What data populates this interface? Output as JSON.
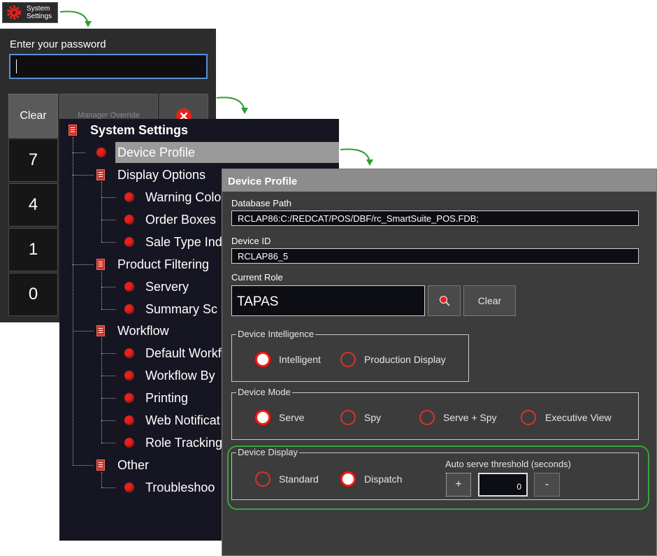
{
  "launcher": {
    "label_line1": "System",
    "label_line2": "Settings",
    "icon": "gear-icon"
  },
  "password_panel": {
    "label": "Enter your password",
    "input_value": "",
    "clear_label": "Clear",
    "manager_override_label": "Manager Override",
    "close_icon": "close-icon",
    "keys": [
      "7",
      "4",
      "1",
      "0"
    ]
  },
  "tree": {
    "title": "System Settings",
    "items": [
      {
        "label": "Device Profile",
        "level": 1,
        "type": "leaf",
        "selected": true
      },
      {
        "label": "Display Options",
        "level": 1,
        "type": "group"
      },
      {
        "label": "Warning Colo",
        "level": 2,
        "type": "leaf"
      },
      {
        "label": "Order Boxes",
        "level": 2,
        "type": "leaf"
      },
      {
        "label": "Sale Type Ind",
        "level": 2,
        "type": "leaf"
      },
      {
        "label": "Product Filtering",
        "level": 1,
        "type": "group"
      },
      {
        "label": "Servery",
        "level": 2,
        "type": "leaf"
      },
      {
        "label": "Summary Sc",
        "level": 2,
        "type": "leaf"
      },
      {
        "label": "Workflow",
        "level": 1,
        "type": "group"
      },
      {
        "label": "Default Workf",
        "level": 2,
        "type": "leaf"
      },
      {
        "label": "Workflow By",
        "level": 2,
        "type": "leaf"
      },
      {
        "label": "Printing",
        "level": 2,
        "type": "leaf"
      },
      {
        "label": "Web Notificat",
        "level": 2,
        "type": "leaf"
      },
      {
        "label": "Role Tracking",
        "level": 2,
        "type": "leaf"
      },
      {
        "label": "Other",
        "level": 1,
        "type": "group"
      },
      {
        "label": "Troubleshoo",
        "level": 2,
        "type": "leaf"
      }
    ]
  },
  "device_profile": {
    "title": "Device Profile",
    "database_path_label": "Database Path",
    "database_path_value": "RCLAP86:C:/REDCAT/POS/DBF/rc_SmartSuite_POS.FDB;",
    "device_id_label": "Device ID",
    "device_id_value": "RCLAP86_5",
    "current_role_label": "Current Role",
    "current_role_value": "TAPAS",
    "search_icon": "search-icon",
    "clear_label": "Clear",
    "device_intelligence": {
      "title": "Device Intelligence",
      "options": [
        "Intelligent",
        "Production Display"
      ],
      "selected": "Intelligent"
    },
    "device_mode": {
      "title": "Device Mode",
      "options": [
        "Serve",
        "Spy",
        "Serve + Spy",
        "Executive View"
      ],
      "selected": "Serve"
    },
    "device_display": {
      "title": "Device Display",
      "options": [
        "Standard",
        "Dispatch"
      ],
      "selected": "Dispatch",
      "threshold_label": "Auto serve threshold (seconds)",
      "threshold_value": "0",
      "plus_label": "+",
      "minus_label": "-"
    }
  },
  "colors": {
    "accent_red": "#e8211b",
    "highlight_green": "#3aa33a",
    "panel_dark": "#2c2c2c",
    "tree_bg": "#161622"
  }
}
